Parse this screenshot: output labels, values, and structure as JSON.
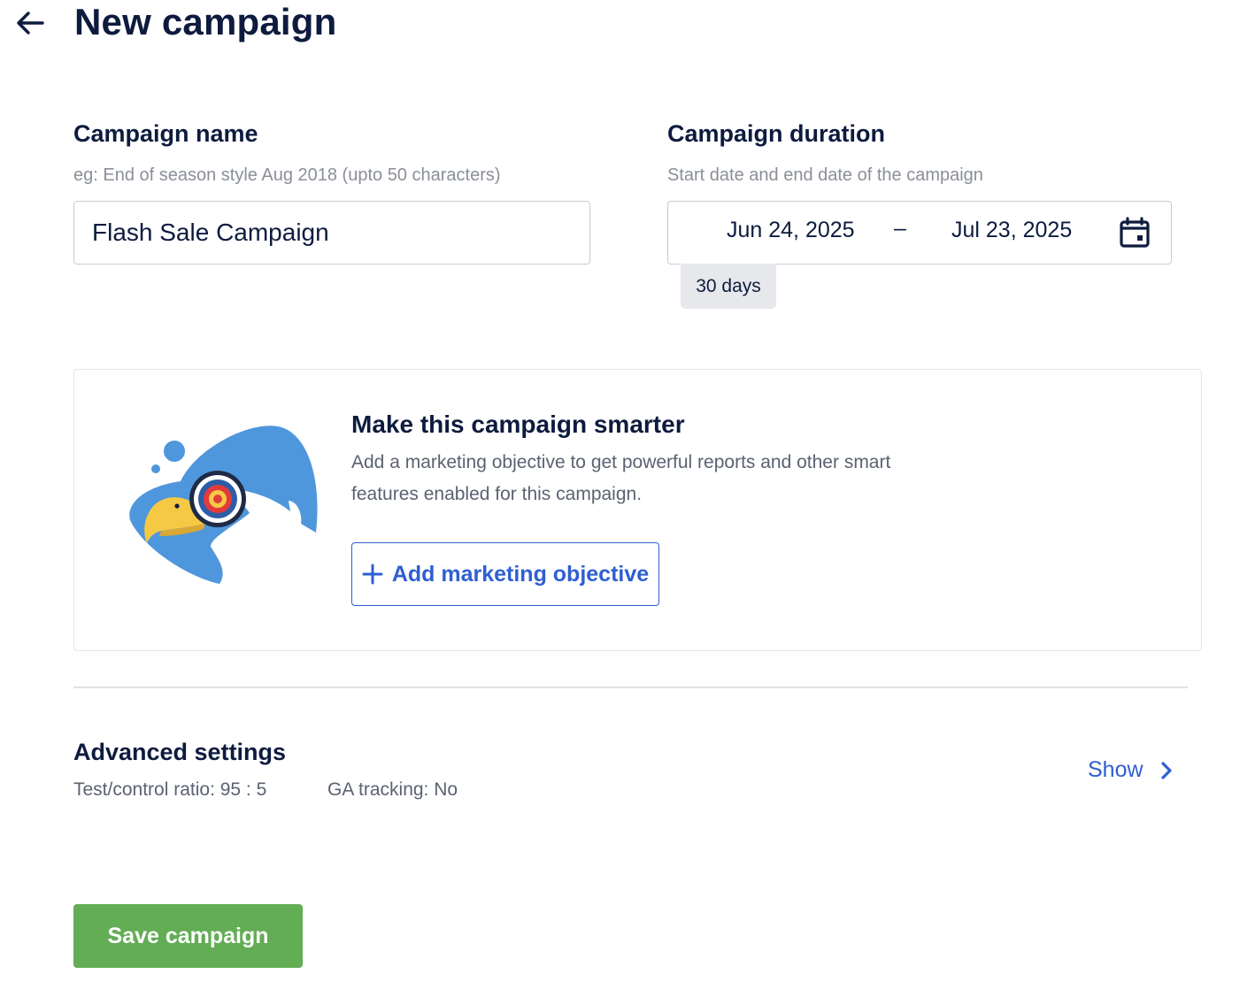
{
  "header": {
    "title": "New campaign",
    "back_icon": "arrow-left-icon"
  },
  "campaign_name": {
    "label": "Campaign name",
    "hint": "eg: End of season style Aug 2018 (upto 50 characters)",
    "value": "Flash Sale Campaign"
  },
  "campaign_duration": {
    "label": "Campaign duration",
    "hint": "Start date and end date of the campaign",
    "start_date": "Jun 24, 2025",
    "separator": "–",
    "end_date": "Jul 23, 2025",
    "duration_badge": "30 days",
    "icon": "calendar-icon"
  },
  "smart_card": {
    "title": "Make this campaign smarter",
    "description": "Add a marketing objective to get powerful reports and other smart features enabled for this campaign.",
    "button_label": "Add marketing objective",
    "illustration": "eagle-target-illustration"
  },
  "advanced_settings": {
    "title": "Advanced settings",
    "test_control_ratio": "Test/control ratio: 95 : 5",
    "ga_tracking": "GA tracking: No",
    "show_label": "Show"
  },
  "footer": {
    "save_label": "Save campaign"
  },
  "colors": {
    "primary_text": "#0d1b3e",
    "link_blue": "#2f5fd0",
    "save_green": "#63ad55",
    "eagle_blue": "#4f97dc",
    "beak_yellow": "#f6c945"
  }
}
